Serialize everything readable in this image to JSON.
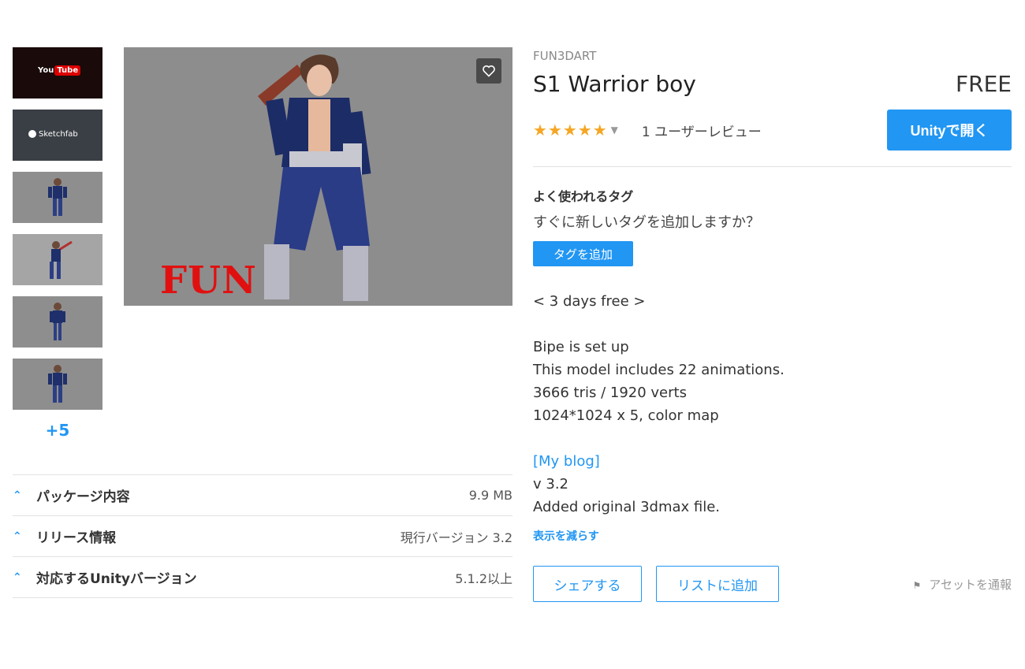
{
  "thumbnails": {
    "youtube_label": "You",
    "youtube_badge": "Tube",
    "sketchfab_label": "Sketchfab",
    "more_label": "+5"
  },
  "hero": {
    "watermark": "FUN"
  },
  "details": [
    {
      "label": "パッケージ内容",
      "value": "9.9 MB"
    },
    {
      "label": "リリース情報",
      "value": "現行バージョン 3.2"
    },
    {
      "label": "対応するUnityバージョン",
      "value": "5.1.2以上"
    }
  ],
  "product": {
    "publisher": "FUN3DART",
    "title": "S1 Warrior boy",
    "price": "FREE",
    "stars": "★★★★★",
    "rating": 5,
    "reviews": "1 ユーザーレビュー",
    "open_button": "Unityで開く"
  },
  "tags": {
    "title": "よく使われるタグ",
    "question": "すぐに新しいタグを追加しますか？",
    "add_button": "タグを追加"
  },
  "description": {
    "line1": "< 3 days free >",
    "line2": "Bipe is set up",
    "line3": "This model includes 22 animations.",
    "line4": "3666 tris / 1920 verts",
    "line5": "1024*1024 x 5, color map",
    "blog": "[My blog]",
    "line6": "v 3.2",
    "line7": "Added original 3dmax file.",
    "show_less": "表示を減らす"
  },
  "actions": {
    "share": "シェアする",
    "add_to_list": "リストに追加",
    "report": "アセットを通報"
  },
  "colors": {
    "accent": "#2196f3",
    "star": "#f5a623",
    "watermark": "#e01010"
  }
}
